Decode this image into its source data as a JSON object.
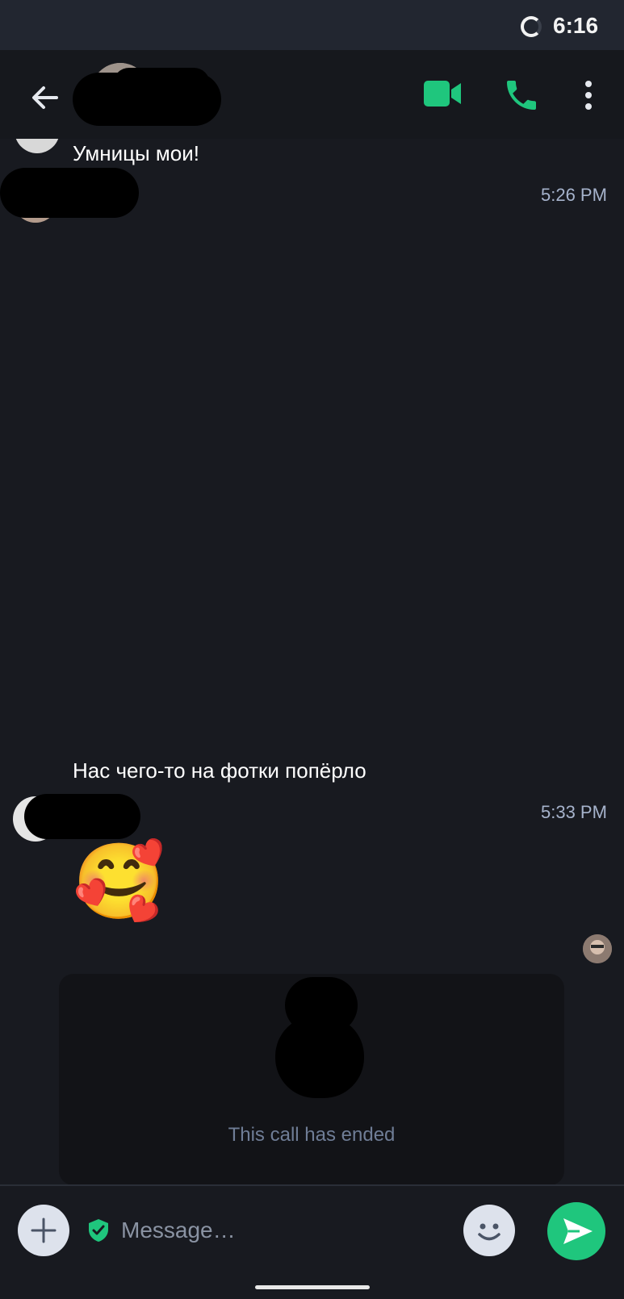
{
  "status_bar": {
    "time": "6:16"
  },
  "header": {
    "back_icon": "arrow-left-icon",
    "video_icon": "video-camera-icon",
    "call_icon": "phone-icon",
    "menu_icon": "more-vertical-icon",
    "accent_color": "#1fc67d"
  },
  "messages": [
    {
      "text": "Умницы мои!",
      "time": "5:26 PM"
    },
    {
      "text": "Нас чего-то на фотки попёрло",
      "time": "5:33 PM"
    },
    {
      "emoji": "🥰"
    }
  ],
  "call_card": {
    "status": "This call has ended"
  },
  "composer": {
    "placeholder": "Message…",
    "add_icon": "plus-icon",
    "secure_icon": "shield-check-icon",
    "emoji_icon": "smiley-icon",
    "send_icon": "send-icon"
  }
}
